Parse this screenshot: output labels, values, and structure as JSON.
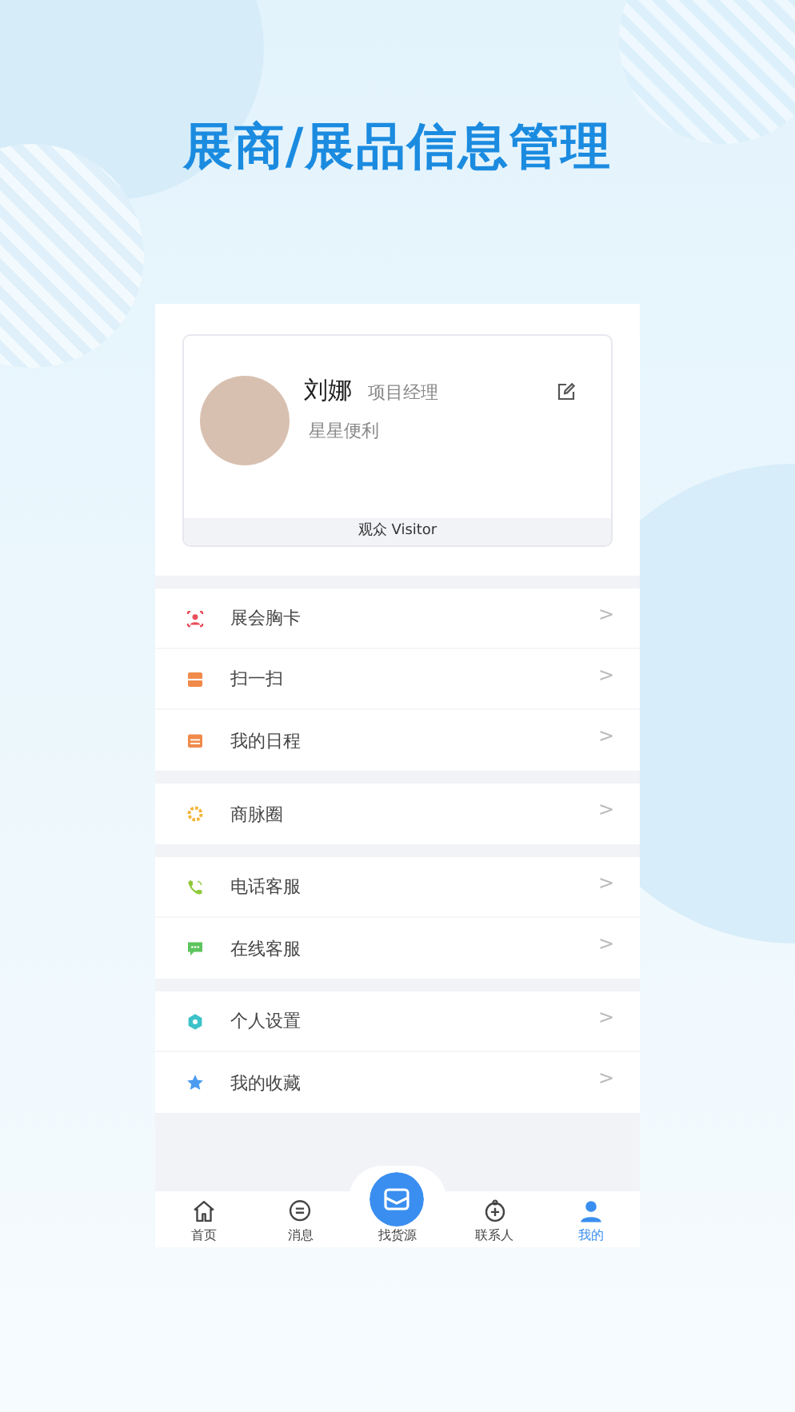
{
  "headline": "展商/展品信息管理",
  "profile": {
    "name": "刘娜",
    "role": "项目经理",
    "company": "星星便利",
    "badge": "观众 Visitor"
  },
  "menu_groups": [
    {
      "items": [
        {
          "label": "展会胸卡",
          "chevron": ">"
        },
        {
          "label": "扫一扫",
          "chevron": ">"
        },
        {
          "label": "我的日程",
          "chevron": ">"
        }
      ]
    },
    {
      "items": [
        {
          "label": "商脉圈",
          "chevron": ">"
        }
      ]
    },
    {
      "items": [
        {
          "label": "电话客服",
          "chevron": ">"
        },
        {
          "label": "在线客服",
          "chevron": ">"
        }
      ]
    },
    {
      "items": [
        {
          "label": "个人设置",
          "chevron": ">"
        },
        {
          "label": "我的收藏",
          "chevron": ">"
        }
      ]
    }
  ],
  "tab_bar": [
    {
      "label": "首页",
      "kind": "normal",
      "selected": false
    },
    {
      "label": "消息",
      "kind": "normal",
      "selected": false
    },
    {
      "label": "找货源",
      "kind": "center",
      "selected": false
    },
    {
      "label": "联系人",
      "kind": "normal",
      "selected": false
    },
    {
      "label": "我的",
      "kind": "normal",
      "selected": true
    }
  ]
}
